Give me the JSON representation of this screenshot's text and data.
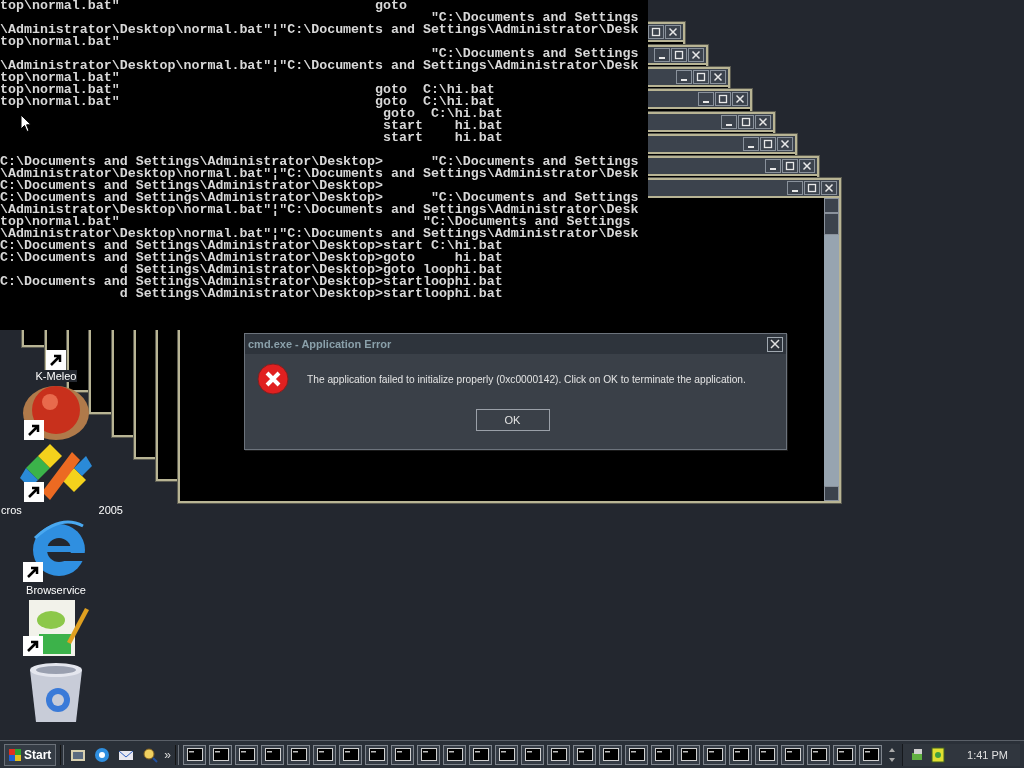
{
  "console": {
    "blocks": [
      [
        "top\\normal.bat\"                                goto",
        "                                                      \"C:\\Documents and Settings",
        "\\Administrator\\Desktop\\normal.bat\"¦\"C:\\Documents and Settings\\Administrator\\Desk",
        "top\\normal.bat\"",
        "                                                      \"C:\\Documents and Settings",
        "\\Administrator\\Desktop\\normal.bat\"¦\"C:\\Documents and Settings\\Administrator\\Desk",
        "top\\normal.bat\"",
        "top\\normal.bat\"                                goto  C:\\hi.bat",
        "top\\normal.bat\"                                goto  C:\\hi.bat",
        "                                                goto  C:\\hi.bat",
        "                                                start    hi.bat",
        "                                                start    hi.bat"
      ],
      [
        "C:\\Documents and Settings\\Administrator\\Desktop>      \"C:\\Documents and Settings",
        "\\Administrator\\Desktop\\normal.bat\"¦\"C:\\Documents and Settings\\Administrator\\Desk",
        "C:\\Documents and Settings\\Administrator\\Desktop>",
        "C:\\Documents and Settings\\Administrator\\Desktop>      \"C:\\Documents and Settings",
        "\\Administrator\\Desktop\\normal.bat\"¦\"C:\\Documents and Settings\\Administrator\\Desk",
        "top\\normal.bat\"                                      \"C:\\Documents and Settings",
        "\\Administrator\\Desktop\\normal.bat\"¦\"C:\\Documents and Settings\\Administrator\\Desk",
        "C:\\Documents and Settings\\Administrator\\Desktop>start C:\\hi.bat",
        "C:\\Documents and Settings\\Administrator\\Desktop>goto     hi.bat",
        "               d Settings\\Administrator\\Desktop>goto loophi.bat",
        "C:\\Documents and Settings\\Administrator\\Desktop>startloophi.bat",
        "               d Settings\\Administrator\\Desktop>startloophi.bat"
      ]
    ]
  },
  "stacked_windows": [
    {
      "kind": "console"
    },
    {
      "kind": "console"
    },
    {
      "kind": "console"
    },
    {
      "kind": "console"
    },
    {
      "kind": "console"
    },
    {
      "kind": "console"
    },
    {
      "kind": "console"
    },
    {
      "kind": "console"
    }
  ],
  "dialog": {
    "title": "cmd.exe - Application Error",
    "message": "The application failed to initialize properly (0xc0000142). Click on OK to terminate the application.",
    "buttons": [
      "OK"
    ]
  },
  "desktop_icons": [
    {
      "kind": "hidden",
      "label": "K-Meleo"
    },
    {
      "kind": "ball"
    },
    {
      "kind": "studio",
      "label_parts": [
        "cros",
        "2005"
      ]
    },
    {
      "kind": "browser",
      "label": "Browservice"
    },
    {
      "kind": "notepad"
    },
    {
      "kind": "recycle"
    }
  ],
  "taskbar": {
    "start_label": "Start",
    "quick_launch": [
      {
        "kind": "desktop"
      },
      {
        "kind": "browser"
      },
      {
        "kind": "mail"
      },
      {
        "kind": "search"
      }
    ],
    "chevron": "»",
    "tasks": [
      {
        "kind": "console"
      },
      {
        "kind": "console"
      },
      {
        "kind": "console"
      },
      {
        "kind": "console"
      },
      {
        "kind": "console"
      },
      {
        "kind": "console"
      },
      {
        "kind": "console"
      },
      {
        "kind": "console"
      },
      {
        "kind": "console"
      },
      {
        "kind": "console"
      },
      {
        "kind": "console"
      },
      {
        "kind": "console"
      },
      {
        "kind": "console"
      },
      {
        "kind": "console"
      },
      {
        "kind": "console"
      },
      {
        "kind": "console"
      },
      {
        "kind": "console"
      },
      {
        "kind": "console"
      },
      {
        "kind": "console"
      },
      {
        "kind": "console"
      },
      {
        "kind": "console"
      },
      {
        "kind": "console"
      },
      {
        "kind": "console"
      },
      {
        "kind": "console"
      },
      {
        "kind": "console"
      },
      {
        "kind": "console"
      },
      {
        "kind": "console"
      }
    ],
    "clock": "1:41 PM"
  }
}
